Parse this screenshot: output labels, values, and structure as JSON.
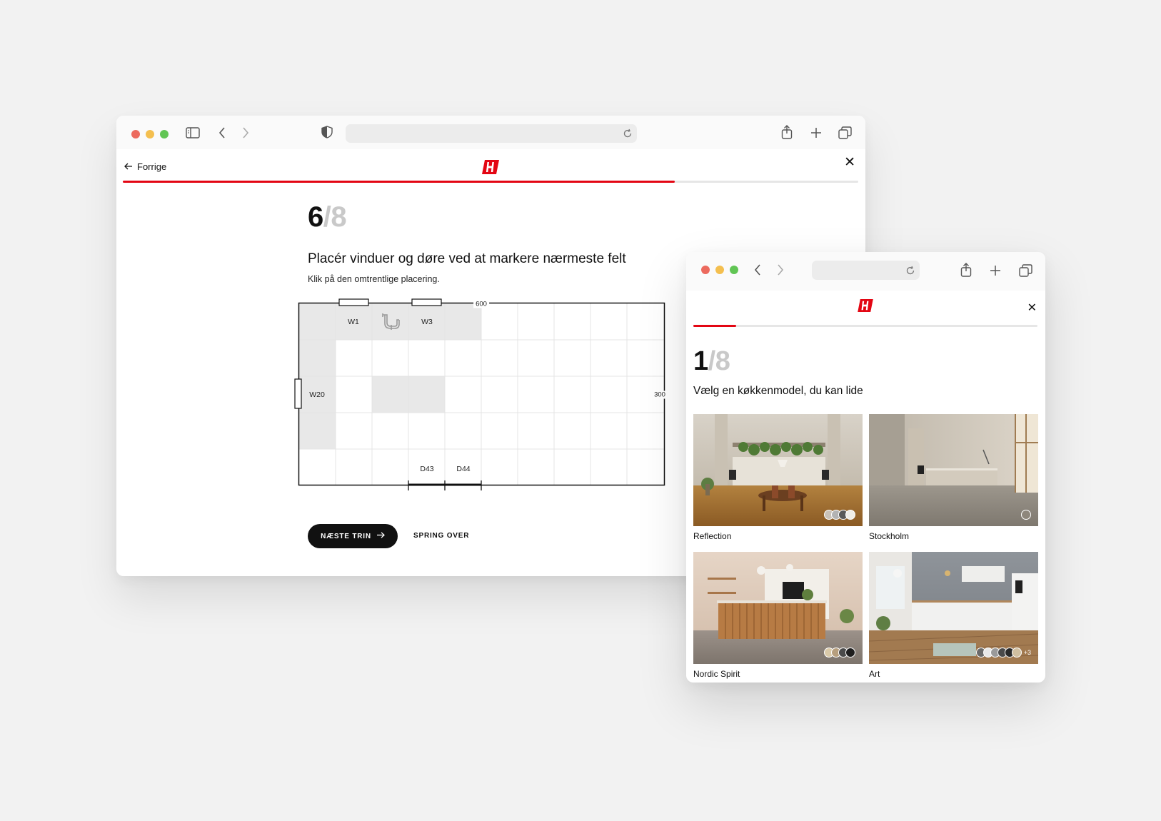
{
  "window1": {
    "nav": {
      "back_label": "Forrige"
    },
    "progress": 0.75,
    "step": {
      "current": "6",
      "separator": "/",
      "total": "8"
    },
    "heading": "Placér vinduer og døre ved at markere nærmeste felt",
    "subheading": "Klik på den omtrentlige placering.",
    "floorplan": {
      "width_label": "600",
      "height_label": "300",
      "labels": {
        "w1": "W1",
        "w3": "W3",
        "w20": "W20",
        "d43": "D43",
        "d44": "D44"
      }
    },
    "buttons": {
      "next": "NÆSTE TRIN",
      "skip": "SPRING OVER"
    }
  },
  "window2": {
    "progress": 0.125,
    "step": {
      "current": "1",
      "separator": "/",
      "total": "8"
    },
    "heading": "Vælg en køkkenmodel, du kan lide",
    "cards": [
      {
        "name": "Reflection",
        "swatches": [
          "#c9c2b8",
          "#b3b3b3",
          "#5a5a5a",
          "#f0eee8"
        ]
      },
      {
        "name": "Stockholm",
        "swatches": [
          "#8e877c"
        ]
      },
      {
        "name": "Nordic Spirit",
        "swatches": [
          "#d9c9a8",
          "#b79f7e",
          "#4a4a4a",
          "#1e1e1e"
        ]
      },
      {
        "name": "Art",
        "swatches": [
          "#6a6a6a",
          "#e8e8e8",
          "#9a9a9a",
          "#4a4a4a",
          "#2a2a2a",
          "#d0bfa0"
        ],
        "more": "+3"
      }
    ]
  },
  "colors": {
    "accent": "#e30613",
    "dark": "#111111"
  }
}
